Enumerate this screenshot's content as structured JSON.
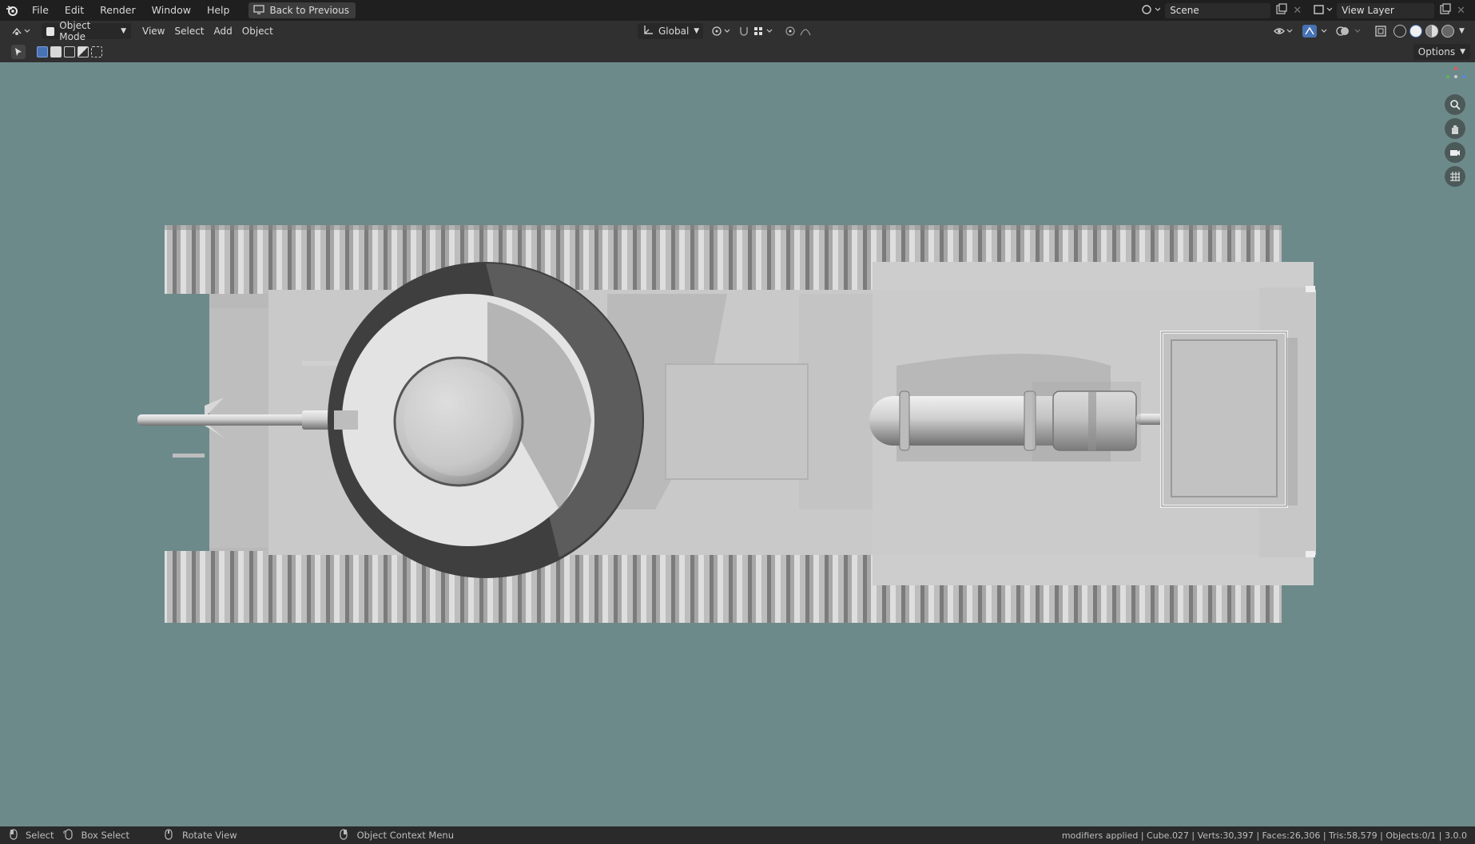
{
  "topbar": {
    "menus": [
      "File",
      "Edit",
      "Render",
      "Window",
      "Help"
    ],
    "back_button": "Back to Previous",
    "scene": "Scene",
    "view_layer": "View Layer"
  },
  "header": {
    "mode": "Object Mode",
    "menus": [
      "View",
      "Select",
      "Add",
      "Object"
    ],
    "transform_orientation": "Global"
  },
  "subbar": {
    "options_label": "Options"
  },
  "statusbar": {
    "select_label": "Select",
    "box_select_label": "Box Select",
    "rotate_label": "Rotate View",
    "context_label": "Object Context Menu",
    "stats": "modifiers applied | Cube.027 | Verts:30,397 | Faces:26,306 | Tris:58,579 | Objects:0/1 | 3.0.0"
  },
  "colors": {
    "viewport_bg": "#6d8a8b",
    "accent": "#4772b3"
  },
  "icons": [
    "blender-logo-icon",
    "zoom-icon",
    "hand-pan-icon",
    "camera-icon",
    "grid-icon"
  ]
}
